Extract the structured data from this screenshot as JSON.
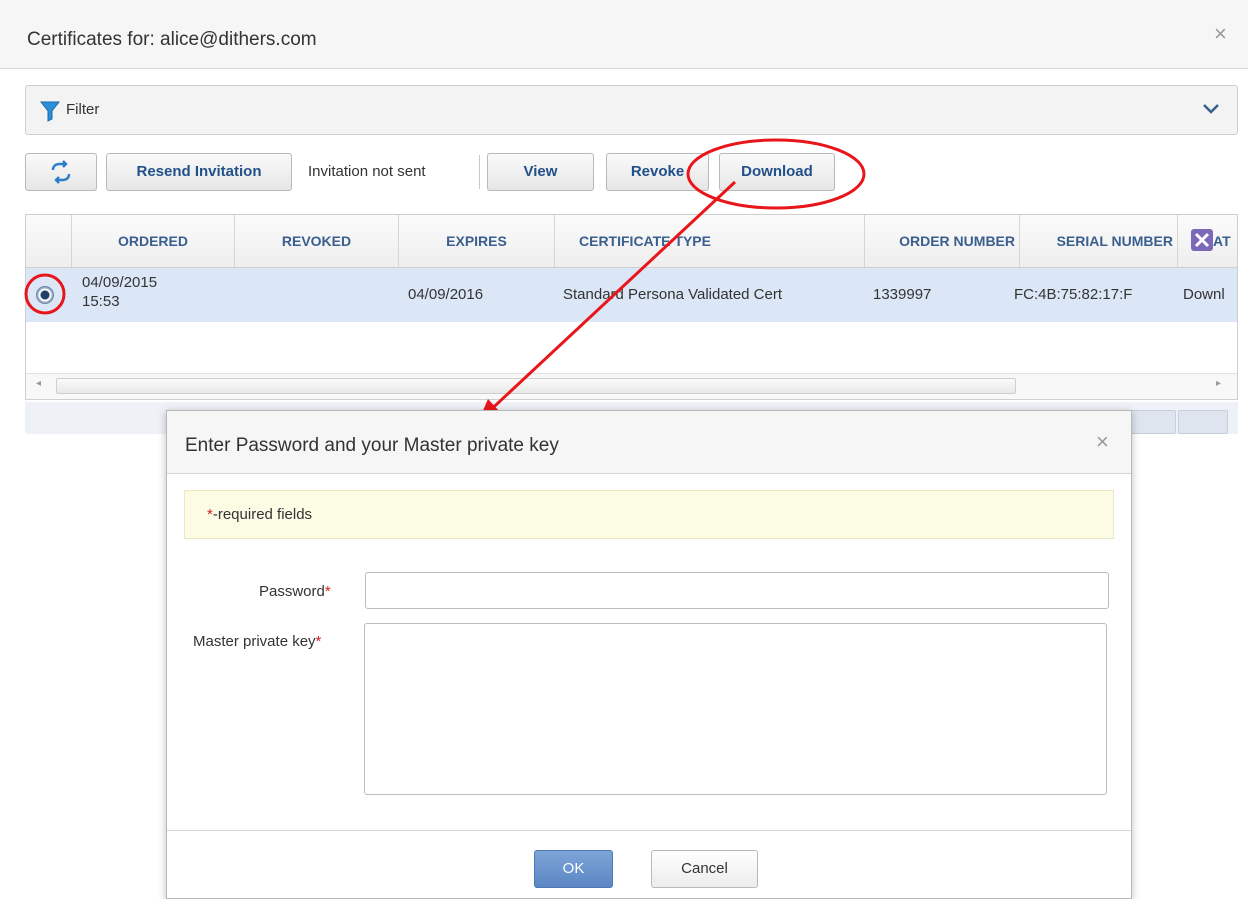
{
  "outer_dialog": {
    "title": "Certificates for: alice@dithers.com",
    "close_glyph": "×",
    "filter_label": "Filter"
  },
  "toolbar": {
    "resend_label": "Resend Invitation",
    "invitation_status": "Invitation not sent",
    "view_label": "View",
    "revoke_label": "Revoke",
    "download_label": "Download"
  },
  "grid": {
    "columns": [
      "ORDERED",
      "REVOKED",
      "EXPIRES",
      "CERTIFICATE TYPE",
      "ORDER NUMBER",
      "SERIAL NUMBER",
      "AT"
    ],
    "row": {
      "ordered": "04/09/2015 15:53",
      "ordered_date": "04/09/2015",
      "ordered_time": "15:53",
      "revoked": "",
      "expires": "04/09/2016",
      "certificate_type": "Standard Persona Validated Cert",
      "order_number": "1339997",
      "serial_number": "FC:4B:75:82:17:F",
      "status": "Downl"
    }
  },
  "modal": {
    "title": "Enter Password and your Master private key",
    "close_glyph": "×",
    "required_star": "*",
    "required_note": "-required fields",
    "password_label": "Password",
    "master_key_label": "Master private key",
    "password_value": "",
    "master_key_value": "",
    "ok_label": "OK",
    "cancel_label": "Cancel"
  },
  "icons": {
    "refresh": "refresh-icon",
    "filter": "filter-icon",
    "chevron": "chevron-down-icon",
    "settings": "tools-icon"
  },
  "colors": {
    "annotation_red": "#e8161b",
    "header_text_blue": "#3a5f8e",
    "selected_row": "#dbe7f6",
    "ok_button": "#5b86c4",
    "required_note_bg": "#fcfbe4"
  }
}
